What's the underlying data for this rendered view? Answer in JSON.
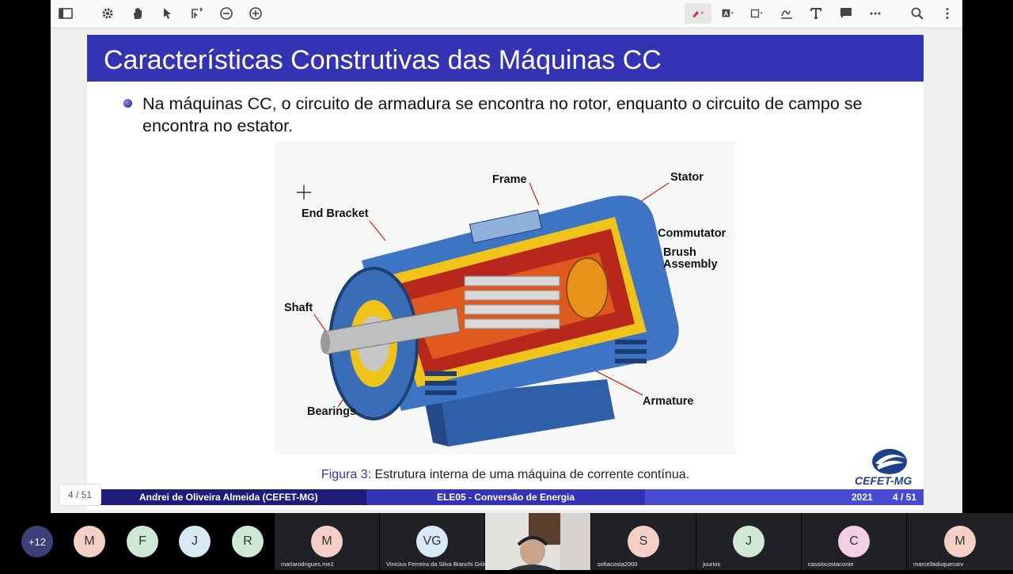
{
  "toolbar": {
    "icons": [
      "sidebar-toggle-icon",
      "settings-icon",
      "hand-icon",
      "pointer-icon",
      "select-icon",
      "zoom-out-icon",
      "zoom-in-icon",
      "pen-icon",
      "text-color-icon",
      "shape-icon",
      "signature-icon",
      "text-tool-icon",
      "comment-icon",
      "more-icon",
      "search-icon",
      "menu-icon"
    ]
  },
  "slide": {
    "title": "Características Construtivas das Máquinas CC",
    "bullet": "Na máquinas CC, o circuito de armadura se encontra no rotor, enquanto o circuito de campo se encontra no estator.",
    "figure_labels": {
      "frame": "Frame",
      "stator": "Stator",
      "end_bracket": "End Bracket",
      "commutator": "Commutator",
      "brush_1": "Brush",
      "brush_2": "Assembly",
      "shaft": "Shaft",
      "bearings": "Bearings",
      "armature": "Armature"
    },
    "caption_prefix": "Figura 3:",
    "caption_text": " Estrutura interna de uma máquina de corrente contínua.",
    "footer_author": "Andrei de Oliveira Almeida  (CEFET-MG)",
    "footer_course": "ELE05 - Conversão de Energia",
    "footer_year": "2021",
    "footer_page": "4 / 51",
    "logo_text": "CEFET-MG"
  },
  "page_indicator": "4 / 51",
  "participants": {
    "more_count": "+12",
    "tiles": [
      {
        "initial": "M",
        "color": "#f6cfc6"
      },
      {
        "initial": "F",
        "color": "#cfe8d6"
      },
      {
        "initial": "J",
        "color": "#d7e9f5"
      },
      {
        "initial": "R",
        "color": "#cfe8d6"
      },
      {
        "initial": "M",
        "color": "#f6cfc6",
        "name": "mariarodrigues.me2"
      },
      {
        "initial": "VG",
        "color": "#d7e9f5",
        "name": "Vinicius Ferreira da Silva Bianchi Grilo"
      },
      {
        "initial": "S",
        "color": "#f6cfc6",
        "name": "sofiacosta2000"
      },
      {
        "initial": "J",
        "color": "#cfe8d6",
        "name": "juurios"
      },
      {
        "initial": "C",
        "color": "#f2cfe3",
        "name": "cassiocostaconte"
      },
      {
        "initial": "M",
        "color": "#f6cfc6",
        "name": "marcelladuquecarv"
      }
    ]
  },
  "colors": {
    "slide_blue": "#3333b3",
    "footer_dark": "#1e1e7a"
  }
}
